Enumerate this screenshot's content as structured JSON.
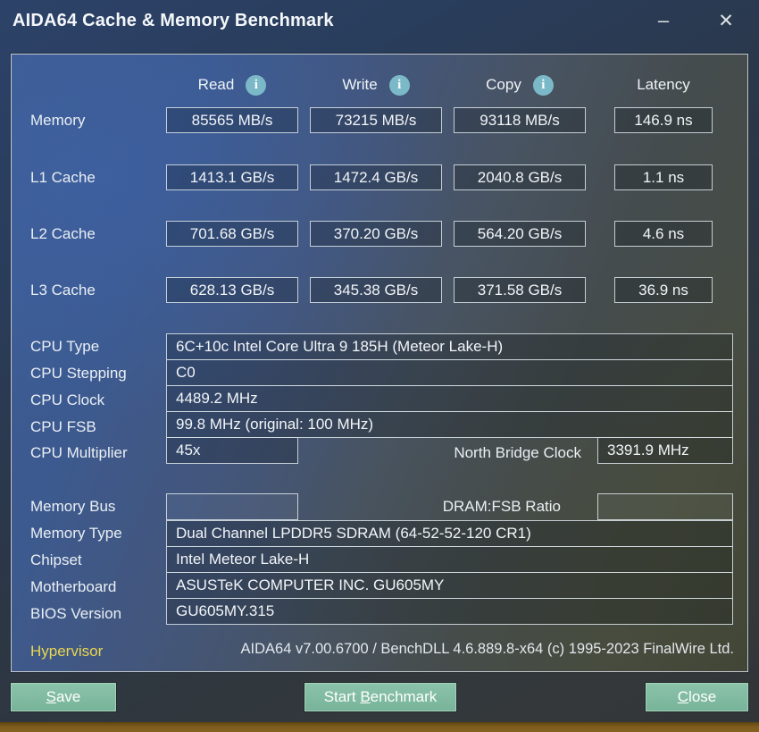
{
  "window": {
    "title": "AIDA64 Cache & Memory Benchmark"
  },
  "icons": {
    "minimize_glyph": "–",
    "close_glyph": "✕",
    "info_glyph": "i"
  },
  "colors": {
    "accent_teal": "#7cb9c8",
    "button_green": "#7fbaa0",
    "hypervisor_yellow": "#e8d64f",
    "panel_blue": "#3e5d94",
    "bottom_strip_brown": "#7d5c1e"
  },
  "benchmark": {
    "columns": [
      {
        "label": "Read"
      },
      {
        "label": "Write"
      },
      {
        "label": "Copy"
      },
      {
        "label": "Latency"
      }
    ],
    "rows": [
      {
        "label": "Memory",
        "read": "85565 MB/s",
        "write": "73215 MB/s",
        "copy": "93118 MB/s",
        "latency": "146.9 ns"
      },
      {
        "label": "L1 Cache",
        "read": "1413.1 GB/s",
        "write": "1472.4 GB/s",
        "copy": "2040.8 GB/s",
        "latency": "1.1 ns"
      },
      {
        "label": "L2 Cache",
        "read": "701.68 GB/s",
        "write": "370.20 GB/s",
        "copy": "564.20 GB/s",
        "latency": "4.6 ns"
      },
      {
        "label": "L3 Cache",
        "read": "628.13 GB/s",
        "write": "345.38 GB/s",
        "copy": "371.58 GB/s",
        "latency": "36.9 ns"
      }
    ]
  },
  "cpu_info": {
    "rows": [
      {
        "label": "CPU Type",
        "value": "6C+10c Intel Core Ultra 9 185H  (Meteor Lake-H)"
      },
      {
        "label": "CPU Stepping",
        "value": "C0"
      },
      {
        "label": "CPU Clock",
        "value": "4489.2 MHz"
      },
      {
        "label": "CPU FSB",
        "value": "99.8 MHz  (original: 100 MHz)"
      }
    ],
    "multiplier": {
      "label": "CPU Multiplier",
      "value": "45x"
    },
    "north_bridge": {
      "label": "North Bridge Clock",
      "value": "3391.9 MHz"
    }
  },
  "memory_info": {
    "bus": {
      "label": "Memory Bus",
      "value": ""
    },
    "dram_fsb": {
      "label": "DRAM:FSB Ratio",
      "value": ""
    },
    "rows": [
      {
        "label": "Memory Type",
        "value": "Dual Channel LPDDR5 SDRAM  (64-52-52-120 CR1)"
      },
      {
        "label": "Chipset",
        "value": "Intel Meteor Lake-H"
      },
      {
        "label": "Motherboard",
        "value": "ASUSTeK COMPUTER INC. GU605MY"
      },
      {
        "label": "BIOS Version",
        "value": "GU605MY.315"
      }
    ]
  },
  "footer": {
    "hypervisor_label": "Hypervisor",
    "version_text": "AIDA64 v7.00.6700 / BenchDLL 4.6.889.8-x64  (c) 1995-2023 FinalWire Ltd."
  },
  "buttons": {
    "save": {
      "pre": "",
      "underline": "S",
      "post": "ave"
    },
    "start": {
      "pre": "Start ",
      "underline": "B",
      "post": "enchmark"
    },
    "close": {
      "pre": "",
      "underline": "C",
      "post": "lose"
    }
  }
}
